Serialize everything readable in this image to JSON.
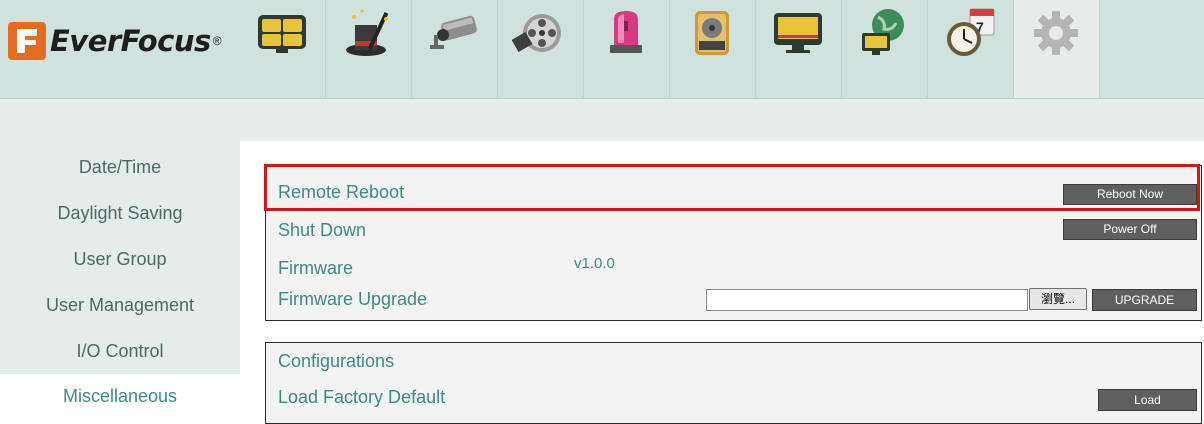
{
  "brand": {
    "name": "EverFocus",
    "reg": "®"
  },
  "toolbar_icons": [
    {
      "name": "live-view-grid-icon"
    },
    {
      "name": "magic-hat-icon"
    },
    {
      "name": "camera-icon"
    },
    {
      "name": "film-reel-icon"
    },
    {
      "name": "alarm-light-icon"
    },
    {
      "name": "hard-disk-icon"
    },
    {
      "name": "monitor-icon"
    },
    {
      "name": "network-globe-icon"
    },
    {
      "name": "schedule-clock-icon"
    },
    {
      "name": "gear-icon"
    }
  ],
  "sidebar": {
    "items": [
      {
        "label": "Date/Time"
      },
      {
        "label": "Daylight Saving"
      },
      {
        "label": "User Group"
      },
      {
        "label": "User Management"
      },
      {
        "label": "I/O Control"
      },
      {
        "label": "Miscellaneous"
      }
    ],
    "active_index": 5
  },
  "system": {
    "remote_reboot": {
      "label": "Remote Reboot",
      "button": "Reboot Now"
    },
    "shut_down": {
      "label": "Shut Down",
      "button": "Power Off"
    },
    "firmware": {
      "label": "Firmware",
      "value": "v1.0.0"
    },
    "firmware_upgrade": {
      "label": "Firmware Upgrade",
      "file_value": "",
      "browse_label": "瀏覽...",
      "button": "UPGRADE"
    }
  },
  "configurations": {
    "title": "Configurations",
    "load_factory_default": {
      "label": "Load Factory Default",
      "button": "Load"
    }
  },
  "colors": {
    "accent_teal": "#3c8a86",
    "highlight_red": "#d41515",
    "header_bg": "#d0e2de",
    "button_gray": "#5f5f5f"
  }
}
